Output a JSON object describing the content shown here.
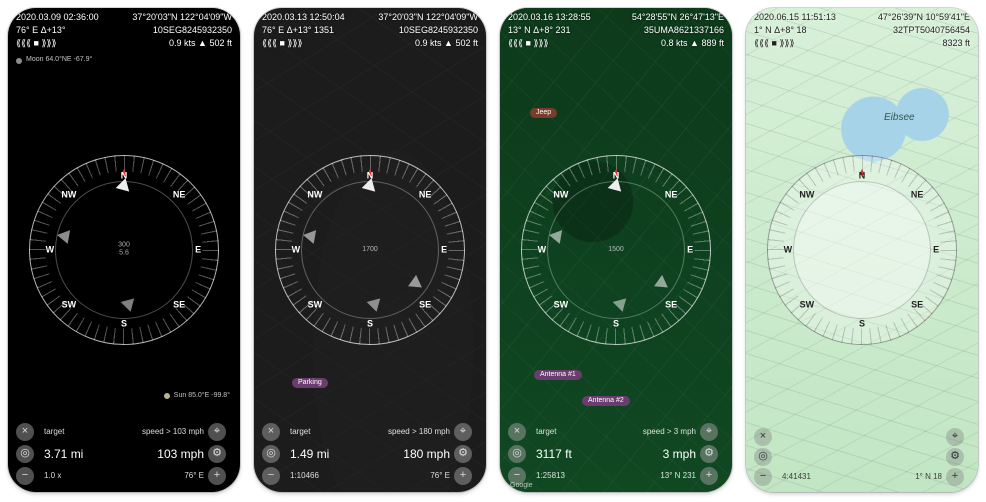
{
  "screens": [
    {
      "dt": "2020.03.09 02:36:00",
      "coords": "37°20'03\"N 122°04'09\"W",
      "heading": "76° E Δ+13°",
      "grid": "10SEG8245932350",
      "speed_alt": "0.9 kts ▲ 502 ft",
      "moon": "Moon 64.0°NE -67.9°",
      "sun": "Sun 85.0°E -99.8°",
      "target_label": "target",
      "target_value": "3.71 mi",
      "speed_label": "speed > 103 mph",
      "speed_value": "103 mph",
      "bl": "1.0 x",
      "br": "76° E",
      "scale_inner": "300",
      "scale_outer": "5.6"
    },
    {
      "dt": "2020.03.13 12:50:04",
      "coords": "37°20'03\"N 122°04'09\"W",
      "heading": "76° E Δ+13° 1351",
      "grid": "10SEG8245932350",
      "speed_alt": "0.9 kts ▲ 502 ft",
      "target_label": "target",
      "target_value": "1.49 mi",
      "speed_label": "speed > 180 mph",
      "speed_value": "180 mph",
      "bl": "1:10466",
      "br": "76° E",
      "marker3": "Parking",
      "scale_inner": "1700"
    },
    {
      "dt": "2020.03.16 13:28:55",
      "coords": "54°28'55\"N 26°47'13\"E",
      "heading": "13° N Δ+8° 231",
      "grid": "35UMA8621337166",
      "speed_alt": "0.8 kts ▲ 889 ft",
      "target_label": "target",
      "target_value": "3117 ft",
      "speed_label": "speed > 3 mph",
      "speed_value": "3 mph",
      "bl": "1:25813",
      "br": "13° N 231",
      "marker1": "Jeep",
      "marker2": "Antenna #1",
      "marker3": "Antenna #2",
      "google": "Google",
      "scale_inner": "1500"
    },
    {
      "dt": "2020.06.15 11:51:13",
      "coords": "47°26'39\"N 10°59'41\"E",
      "heading": "1° N Δ+8° 18",
      "grid": "32TPT5040756454",
      "speed_alt": "8323 ft",
      "lake": "Eibsee",
      "bl": "4:41431",
      "br": "1° N 18"
    }
  ],
  "cardinals": {
    "n": "N",
    "ne": "NE",
    "e": "E",
    "se": "SE",
    "s": "S",
    "sw": "SW",
    "w": "W",
    "nw": "NW"
  },
  "strip": "⟪⟪⟪ ■ ⟫⟫⟫"
}
